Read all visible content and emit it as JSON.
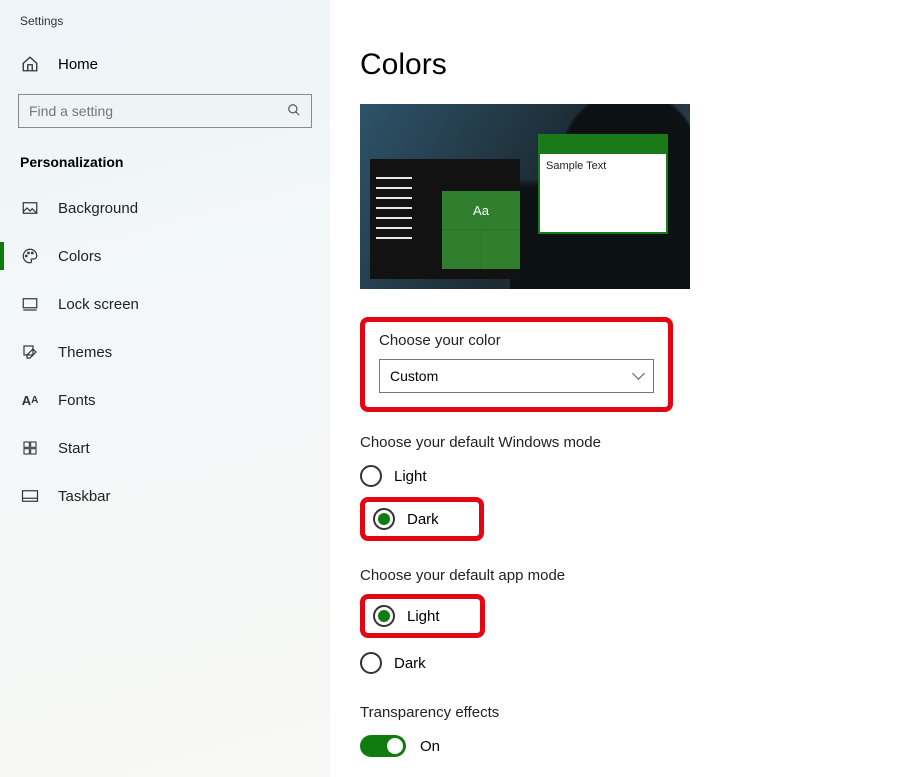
{
  "window_title": "Settings",
  "home_label": "Home",
  "search": {
    "placeholder": "Find a setting"
  },
  "section": "Personalization",
  "nav": {
    "items": [
      {
        "label": "Background",
        "active": false
      },
      {
        "label": "Colors",
        "active": true
      },
      {
        "label": "Lock screen",
        "active": false
      },
      {
        "label": "Themes",
        "active": false
      },
      {
        "label": "Fonts",
        "active": false
      },
      {
        "label": "Start",
        "active": false
      },
      {
        "label": "Taskbar",
        "active": false
      }
    ]
  },
  "page_title": "Colors",
  "preview": {
    "tile_text": "Aa",
    "sample_window_text": "Sample Text"
  },
  "choose_color": {
    "label": "Choose your color",
    "value": "Custom"
  },
  "windows_mode": {
    "label": "Choose your default Windows mode",
    "options": {
      "light": "Light",
      "dark": "Dark"
    },
    "selected": "dark"
  },
  "app_mode": {
    "label": "Choose your default app mode",
    "options": {
      "light": "Light",
      "dark": "Dark"
    },
    "selected": "light"
  },
  "transparency": {
    "label": "Transparency effects",
    "state_label": "On"
  }
}
